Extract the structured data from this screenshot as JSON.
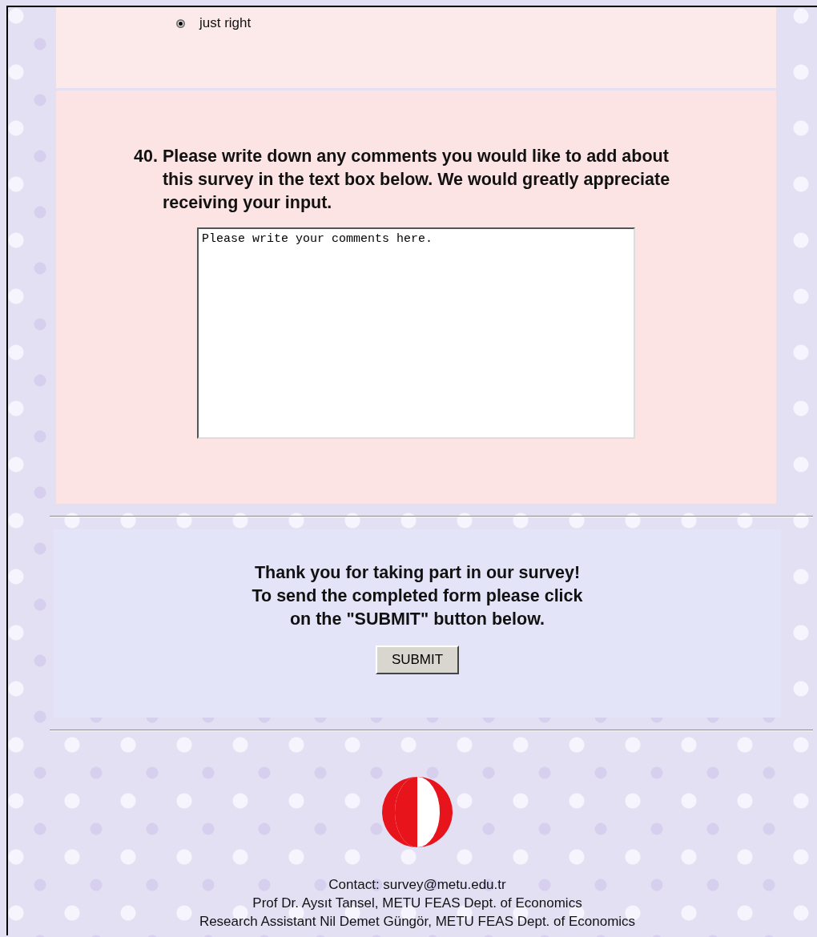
{
  "previous_question": {
    "options": [
      {
        "label": "just right",
        "selected": true
      }
    ]
  },
  "question": {
    "number": "40.",
    "text": "Please write down any comments you would like to add about this survey in the text box below. We would greatly appreciate receiving your input.",
    "comment_value": "Please write your comments here."
  },
  "closing": {
    "lines": [
      "Thank you for taking part in our survey!",
      "To send the completed form please click",
      "on the \"SUBMIT\" button below."
    ],
    "button": "SUBMIT"
  },
  "footer": {
    "lines": [
      "Contact: survey@metu.edu.tr",
      "Prof Dr. Aysıt Tansel, METU FEAS Dept. of Economics",
      "Research Assistant Nil Demet Güngör, METU FEAS Dept. of Economics"
    ]
  }
}
